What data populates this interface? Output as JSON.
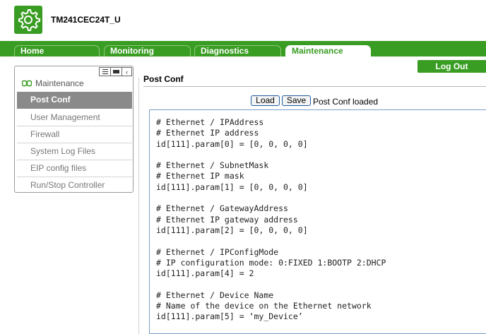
{
  "header": {
    "device_name": "TM241CEC24T_U",
    "logo_icon": "gear-icon",
    "accent_color": "#3a9d23"
  },
  "tabs": [
    {
      "label": "Home"
    },
    {
      "label": "Monitoring"
    },
    {
      "label": "Diagnostics"
    },
    {
      "label": "Maintenance",
      "active": true
    }
  ],
  "logout_label": "Log Out",
  "sidebar": {
    "title": "Maintenance",
    "title_icon": "maintenance-icon",
    "items": [
      {
        "label": "Post Conf",
        "active": true
      },
      {
        "label": "User Management"
      },
      {
        "label": "Firewall"
      },
      {
        "label": "System Log Files"
      },
      {
        "label": "EIP config files"
      },
      {
        "label": "Run/Stop Controller"
      }
    ]
  },
  "main": {
    "title": "Post Conf",
    "load_label": "Load",
    "save_label": "Save",
    "status": "Post Conf loaded",
    "code_lines": [
      "# Ethernet / IPAddress",
      "# Ethernet IP address",
      "id[111].param[0] = [0, 0, 0, 0]",
      "",
      "# Ethernet / SubnetMask",
      "# Ethernet IP mask",
      "id[111].param[1] = [0, 0, 0, 0]",
      "",
      "# Ethernet / GatewayAddress",
      "# Ethernet IP gateway address",
      "id[111].param[2] = [0, 0, 0, 0]",
      "",
      "# Ethernet / IPConfigMode",
      "# IP configuration mode: 0:FIXED 1:BOOTP 2:DHCP",
      "id[111].param[4] = 2",
      "",
      "# Ethernet / Device Name",
      "# Name of the device on the Ethernet network",
      "id[111].param[5] = ‘my_Device’"
    ]
  }
}
